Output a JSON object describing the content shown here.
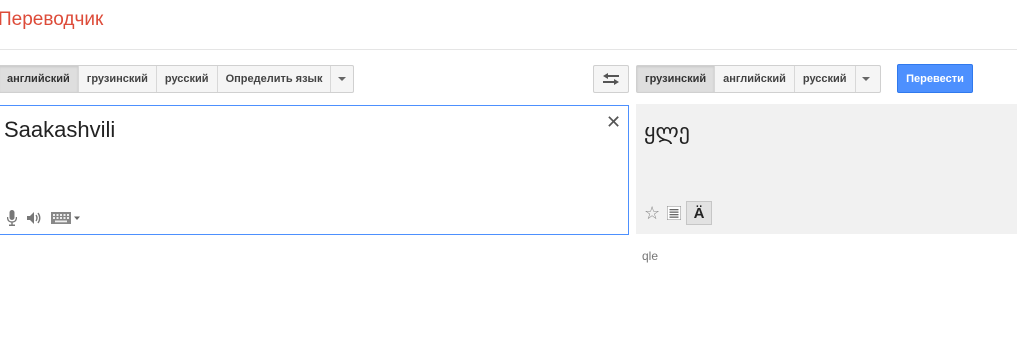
{
  "app": {
    "title": "Переводчик"
  },
  "source": {
    "languages": [
      "английский",
      "грузинский",
      "русский",
      "Определить язык"
    ],
    "selected_index": 0,
    "text": "Saakashvili",
    "clear_glyph": "✕"
  },
  "target": {
    "languages": [
      "грузинский",
      "английский",
      "русский"
    ],
    "selected_index": 0,
    "translate_label": "Перевести",
    "translation_text": "ყლე",
    "transliteration": "qle",
    "phonetic_glyph": "Ä",
    "star_glyph": "☆"
  },
  "icons": {
    "swap": "swap-languages-icon",
    "mic": "microphone-icon",
    "speaker": "speaker-icon",
    "keyboard": "keyboard-icon",
    "list": "list-icon"
  },
  "colors": {
    "title": "#dd4b39",
    "translate_button": "#4d90fe",
    "source_border": "#4d90fe",
    "target_background": "#f1f1f1"
  }
}
